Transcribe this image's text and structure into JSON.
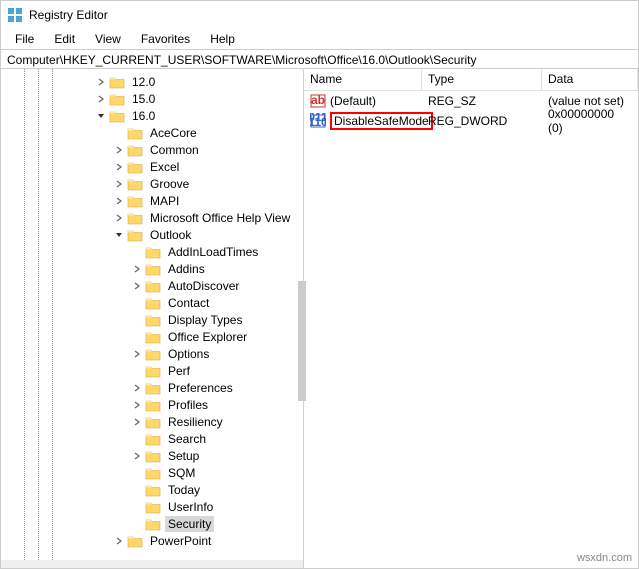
{
  "title": "Registry Editor",
  "menu": {
    "file": "File",
    "edit": "Edit",
    "view": "View",
    "favorites": "Favorites",
    "help": "Help"
  },
  "address": "Computer\\HKEY_CURRENT_USER\\SOFTWARE\\Microsoft\\Office\\16.0\\Outlook\\Security",
  "tree": {
    "v120": "12.0",
    "v150": "15.0",
    "v160": "16.0",
    "acecore": "AceCore",
    "common": "Common",
    "excel": "Excel",
    "groove": "Groove",
    "mapi": "MAPI",
    "mohv": "Microsoft Office Help View",
    "outlook": "Outlook",
    "addinloadtimes": "AddInLoadTimes",
    "addins": "Addins",
    "autodiscover": "AutoDiscover",
    "contact": "Contact",
    "displaytypes": "Display Types",
    "officeexplorer": "Office Explorer",
    "options": "Options",
    "perf": "Perf",
    "preferences": "Preferences",
    "profiles": "Profiles",
    "resiliency": "Resiliency",
    "search": "Search",
    "setup": "Setup",
    "sqm": "SQM",
    "today": "Today",
    "userinfo": "UserInfo",
    "security": "Security",
    "powerpoint": "PowerPoint"
  },
  "grid": {
    "hdr": {
      "name": "Name",
      "type": "Type",
      "data": "Data"
    },
    "r0": {
      "name": "(Default)",
      "type": "REG_SZ",
      "data": "(value not set)"
    },
    "r1": {
      "name": "DisableSafeMode",
      "type": "REG_DWORD",
      "data": "0x00000000 (0)"
    }
  },
  "watermark": "wsxdn.com"
}
